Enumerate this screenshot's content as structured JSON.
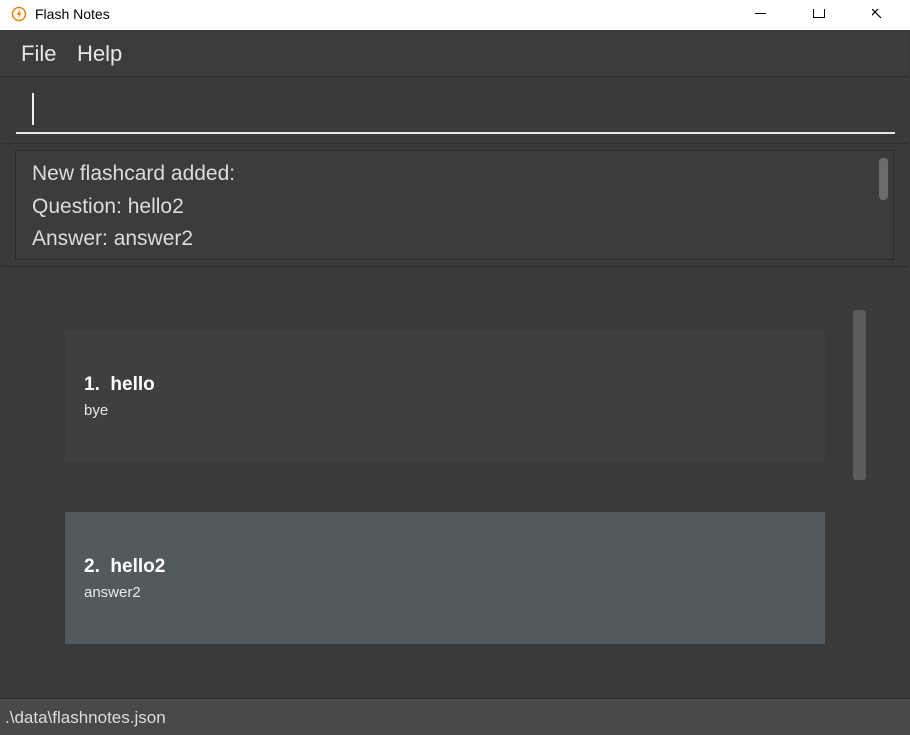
{
  "window": {
    "title": "Flash Notes"
  },
  "menu": {
    "items": [
      {
        "label": "File"
      },
      {
        "label": "Help"
      }
    ]
  },
  "command_box": {
    "value": ""
  },
  "result": {
    "lines": [
      "New flashcard added:",
      "Question: hello2",
      "Answer: answer2"
    ]
  },
  "flashcards": [
    {
      "index": "1.",
      "question": "hello",
      "answer": "bye",
      "selected": false
    },
    {
      "index": "2.",
      "question": "hello2",
      "answer": "answer2",
      "selected": true
    }
  ],
  "status_bar": {
    "path": ".\\data\\flashnotes.json"
  },
  "colors": {
    "app_background": "#3a3a3a",
    "card_background": "#3e3f41",
    "card_selected_background": "#535a5e",
    "icon_accent": "#e8861a"
  },
  "icons": {
    "app": "flash-lightning-icon",
    "minimize": "minimize-icon",
    "maximize": "maximize-icon",
    "close": "close-icon"
  }
}
